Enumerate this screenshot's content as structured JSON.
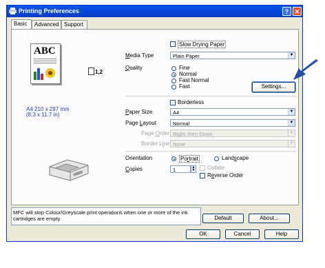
{
  "window": {
    "title": "Printing Preferences",
    "help_glyph": "?",
    "close_glyph": "✕"
  },
  "tabs": [
    {
      "label": "Basic"
    },
    {
      "label": "Advanced"
    },
    {
      "label": "Support"
    }
  ],
  "preview": {
    "doc_text": "ABC",
    "copies_badge": "1,2",
    "paper_dims": "A4 210 x 297 mm",
    "paper_dims_in": "(8.3 x 11.7 in)"
  },
  "options": {
    "slow_drying": "Slow Drying Paper",
    "media_type": {
      "label": "Media Type",
      "value": "Plain Paper"
    },
    "quality": {
      "label": "Quality",
      "options": [
        "Fine",
        "Normal",
        "Fast Normal",
        "Fast"
      ],
      "selected": "Normal"
    },
    "settings_button": "Settings...",
    "borderless": "Borderless",
    "paper_size": {
      "label": "Paper Size",
      "value": "A4"
    },
    "page_layout": {
      "label": "Page Layout",
      "value": "Normal"
    },
    "page_order": {
      "label": "Page Order",
      "value": "Right, then Down"
    },
    "border_line": {
      "label": "Border Line",
      "value": "None"
    },
    "orientation": {
      "label": "Orientation",
      "options": [
        "Portrait",
        "Landscape"
      ],
      "selected": "Portrait"
    },
    "copies": {
      "label": "Copies",
      "value": "1",
      "collate": "Collate",
      "reverse": "Reverse Order"
    }
  },
  "message": "MFC will stop Colour/Greyscale print operations when one or more of the ink cartridges are empty.",
  "buttons": {
    "default": "Default",
    "about": "About...",
    "ok": "OK",
    "cancel": "Cancel",
    "help": "Help"
  },
  "colors": {
    "titlebar": "#0544d6",
    "arrow": "#1f4fa0",
    "accent_blue": "#1e3fa8"
  }
}
